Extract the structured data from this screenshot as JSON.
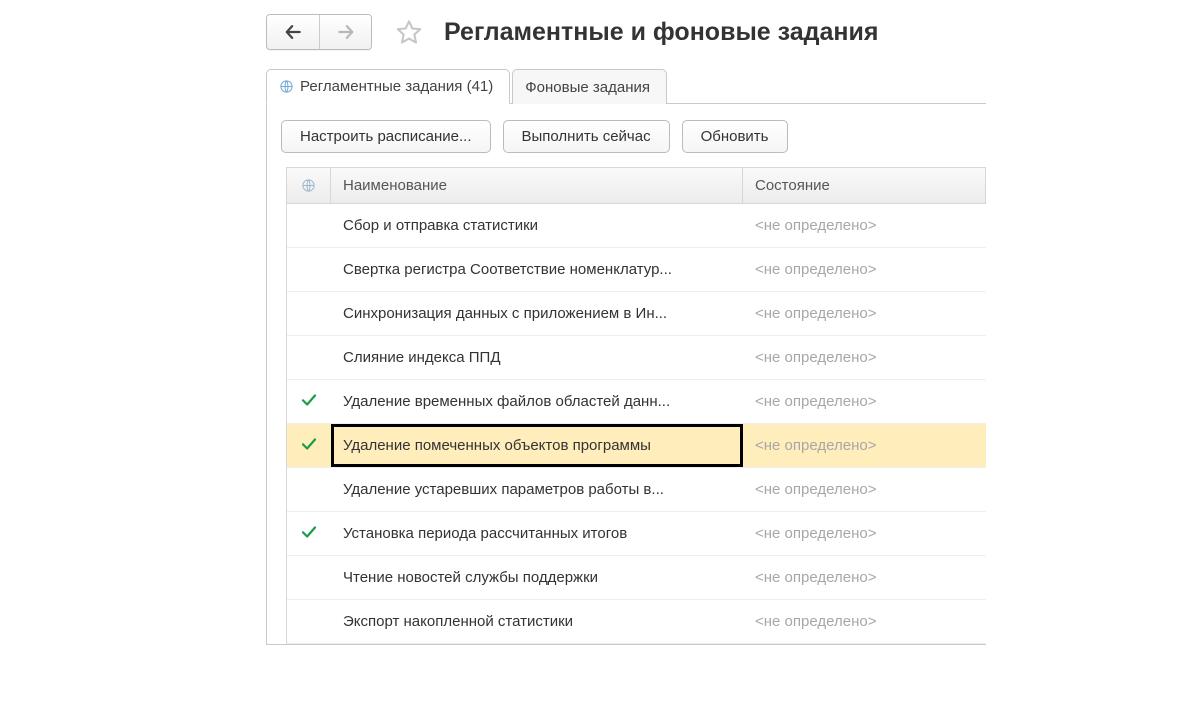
{
  "header": {
    "title": "Регламентные и фоновые задания"
  },
  "tabs": {
    "scheduled": "Регламентные задания (41)",
    "background": "Фоновые задания"
  },
  "toolbar": {
    "schedule": "Настроить расписание...",
    "run_now": "Выполнить сейчас",
    "refresh": "Обновить"
  },
  "grid": {
    "headers": {
      "name": "Наименование",
      "state": "Состояние"
    },
    "status_undefined": "<не определено>",
    "rows": [
      {
        "checked": false,
        "name": "Сбор и отправка статистики",
        "selected": false
      },
      {
        "checked": false,
        "name": "Свертка регистра Соответствие номенклатур...",
        "selected": false
      },
      {
        "checked": false,
        "name": "Синхронизация данных с приложением в Ин...",
        "selected": false
      },
      {
        "checked": false,
        "name": "Слияние индекса ППД",
        "selected": false
      },
      {
        "checked": true,
        "name": "Удаление временных файлов областей данн...",
        "selected": false
      },
      {
        "checked": true,
        "name": "Удаление помеченных объектов программы",
        "selected": true
      },
      {
        "checked": false,
        "name": "Удаление устаревших параметров работы в...",
        "selected": false
      },
      {
        "checked": true,
        "name": "Установка периода рассчитанных итогов",
        "selected": false
      },
      {
        "checked": false,
        "name": "Чтение новостей службы поддержки",
        "selected": false
      },
      {
        "checked": false,
        "name": "Экспорт накопленной статистики",
        "selected": false
      }
    ]
  }
}
